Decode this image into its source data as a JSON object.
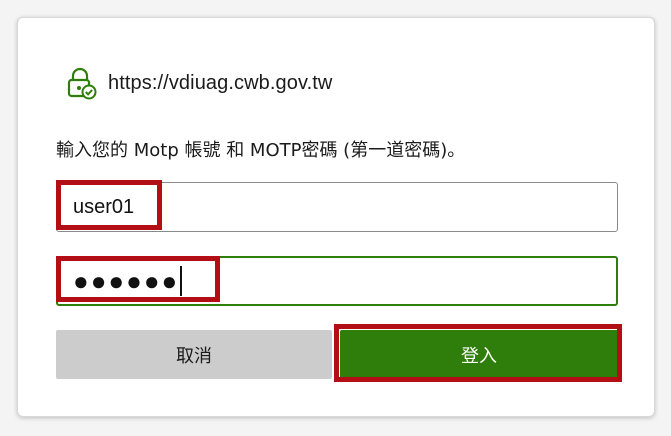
{
  "dialog": {
    "site_url": "https://vdiuag.cwb.gov.tw",
    "site_icon": "lock-check-icon",
    "prompt": "輸入您的 Motp 帳號 和 MOTP密碼 (第一道密碼)。",
    "username_value": "user01",
    "password_mask": "●●●●●●",
    "cancel_label": "取消",
    "login_label": "登入"
  },
  "colors": {
    "accent_green": "#2f7d0a",
    "cancel_gray": "#cccccc",
    "highlight_red": "#b30d16"
  }
}
